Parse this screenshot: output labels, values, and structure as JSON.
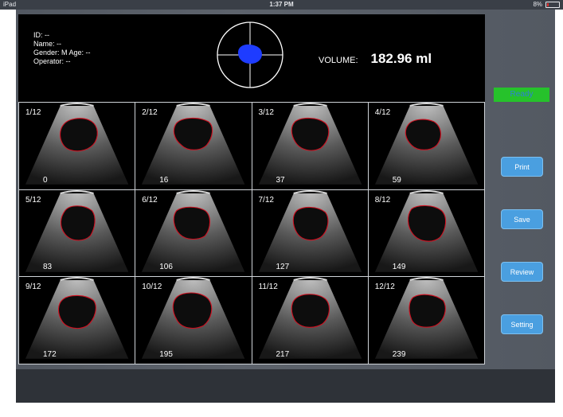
{
  "status_bar": {
    "device": "iPad",
    "time": "1:37 PM",
    "battery": "8%"
  },
  "patient_info": {
    "id": "ID: --",
    "name": "Name: --",
    "gender_age": "Gender: M    Age: --",
    "operator": "Operator: --"
  },
  "volume": {
    "label": "VOLUME:",
    "value": "182.96 ml"
  },
  "ready": {
    "label": "Ready"
  },
  "buttons": {
    "print": "Print",
    "save": "Save",
    "review": "Review",
    "setting": "Setting"
  },
  "scans": [
    {
      "frame": "1/12",
      "time": "0"
    },
    {
      "frame": "2/12",
      "time": "16"
    },
    {
      "frame": "3/12",
      "time": "37"
    },
    {
      "frame": "4/12",
      "time": "59"
    },
    {
      "frame": "5/12",
      "time": "83"
    },
    {
      "frame": "6/12",
      "time": "106"
    },
    {
      "frame": "7/12",
      "time": "127"
    },
    {
      "frame": "8/12",
      "time": "149"
    },
    {
      "frame": "9/12",
      "time": "172"
    },
    {
      "frame": "10/12",
      "time": "195"
    },
    {
      "frame": "11/12",
      "time": "217"
    },
    {
      "frame": "12/12",
      "time": "239"
    }
  ],
  "colors": {
    "ready_bg": "#26c22b",
    "button_bg": "#4a9fe0",
    "target_blob": "#1e3cff",
    "contour": "#d01020"
  }
}
